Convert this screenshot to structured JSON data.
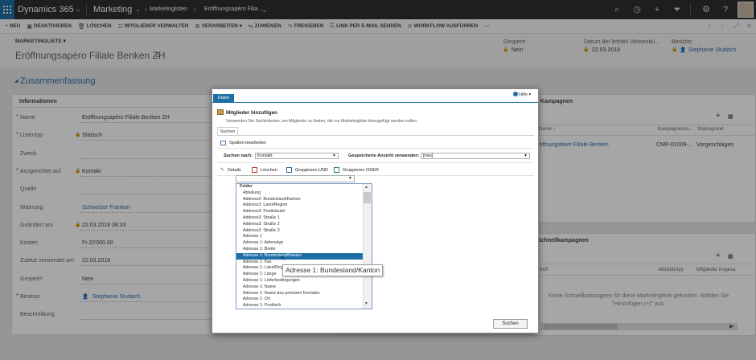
{
  "topbar": {
    "app": "Dynamics 365",
    "area": "Marketing",
    "crumbs": [
      "Marketinglisten",
      "Eröffnungsapéro Filia..."
    ],
    "icons": [
      "search-icon",
      "history-icon",
      "plus-icon",
      "filter-icon",
      "gear-icon",
      "help-icon",
      "user-avatar"
    ]
  },
  "commands": [
    {
      "icon": "+",
      "label": "Neu"
    },
    {
      "icon": "▣",
      "label": "Deaktivieren"
    },
    {
      "icon": "🗑",
      "label": "Löschen"
    },
    {
      "icon": "☷",
      "label": "Mitglieder verwalten"
    },
    {
      "icon": "⚙",
      "label": "Verarbeiten ▾"
    },
    {
      "icon": "⇆",
      "label": "Zuweisen"
    },
    {
      "icon": "↷",
      "label": "Freigeben"
    },
    {
      "icon": "⎘",
      "label": "Link per E-Mail senden"
    },
    {
      "icon": "⟳",
      "label": "Workflow ausführen"
    },
    {
      "icon": "",
      "label": "···"
    }
  ],
  "header": {
    "entity": "MARKETINGLISTE ▾",
    "title": "Eröffnungsapéro Filiale Benken ZH",
    "fields": [
      {
        "label": "Gesperrt",
        "value": "Nein",
        "link": false
      },
      {
        "label": "Datum der letzten Verwendu...",
        "value": "22.03.2018",
        "link": false
      },
      {
        "label": "Besitzer",
        "value": "Stephanie Studach",
        "link": true
      }
    ]
  },
  "summary": {
    "section_title": "Zusammenfassung",
    "info_title": "Informationen",
    "rows": [
      {
        "label": "Name",
        "req": true,
        "value": "Eröffnungsapéro Filiale Benken ZH",
        "lock": false,
        "link": false
      },
      {
        "label": "Listentyp",
        "req": true,
        "value": "Statisch",
        "lock": true,
        "link": false
      },
      {
        "label": "Zweck",
        "req": false,
        "value": "",
        "lock": false,
        "link": false
      },
      {
        "label": "Ausgerichtet auf",
        "req": true,
        "value": "Kontakt",
        "lock": true,
        "link": false
      },
      {
        "label": "Quelle",
        "req": false,
        "value": "",
        "lock": false,
        "link": false
      },
      {
        "label": "Währung",
        "req": false,
        "value": "Schweizer Franken",
        "lock": false,
        "link": true
      },
      {
        "label": "Geändert am",
        "req": false,
        "value": "22.03.2018   08:33",
        "lock": true,
        "link": false
      },
      {
        "label": "Kosten",
        "req": false,
        "value": "Fr.15'000.00",
        "lock": false,
        "link": false
      },
      {
        "label": "Zuletzt verwendet am",
        "req": false,
        "value": "22.03.2018",
        "lock": false,
        "link": false
      },
      {
        "label": "Gesperrt",
        "req": false,
        "value": "Nein",
        "lock": false,
        "link": false
      },
      {
        "label": "Besitzer",
        "req": true,
        "value": "Stephanie Studach",
        "lock": false,
        "link": true
      },
      {
        "label": "Beschreibung",
        "req": false,
        "value": "",
        "lock": false,
        "link": false
      }
    ]
  },
  "campaigns": {
    "title": "Kampagnen",
    "columns": [
      "Name ↑",
      "Kampagnenco...",
      "Statusgrund"
    ],
    "row": [
      "röffnungsfeier Filiale Benken",
      "CMP-01009-...",
      "Vorgeschlagen"
    ]
  },
  "quick": {
    "title": "Schnellkampagnen",
    "columns": [
      "treff",
      "Aktivitätstyp",
      "Mitglieder insgesa"
    ],
    "empty": "Keine Schnellkampagnen für diese Marketingliste gefunden. Wählen Sie \"Hinzufügen (+)\" aus."
  },
  "dialog": {
    "tab": "Daten",
    "help": "Hilfe ▾",
    "title": "Mitglieder hinzufügen",
    "subtitle": "Verwenden Sie Suchkriterien, um Mitglieder zu finden, die zur Marketingliste hinzugefügt werden sollen.",
    "search_tab": "Suchen",
    "edit_columns": "Spalten bearbeiten",
    "search_for_label": "Suchen nach:",
    "search_for_value": "Kontakt",
    "saved_view_label": "Gespeicherte Ansicht verwenden:",
    "saved_view_value": "[neu]",
    "toolbar": [
      "Details",
      "Löschen",
      "Gruppieren UND",
      "Gruppieren ODER"
    ],
    "search_button": "Suchen",
    "list_header": "Felder",
    "fields": [
      "Abteilung",
      "Address3: Bundesland/Kanton",
      "Address3: Land/Region",
      "Address3: Postleitzahl",
      "Address3: Straße 1",
      "Address3: Straße 2",
      "Address3: Straße 3",
      "Adresse 1",
      "Adresse 1: Adresstyp",
      "Adresse 1: Breite",
      "Adresse 1: Bundesland/Kanton",
      "Adresse 1: Fax",
      "Adresse 1: Land/Region",
      "Adresse 1: Länge",
      "Adresse 1: Lieferbedingungen",
      "Adresse 1: Name",
      "Adresse 1: Name des primären Kontakts",
      "Adresse 1: Ort",
      "Adresse 1: Postfach"
    ],
    "highlighted_index": 10,
    "tooltip": "Adresse 1: Bundesland/Kanton"
  }
}
